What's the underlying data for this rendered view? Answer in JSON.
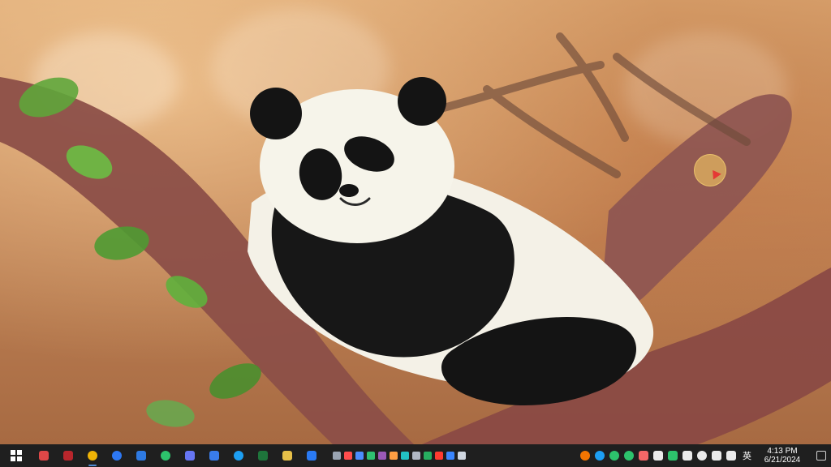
{
  "wallpaper": {
    "subject": "sleeping-panda-on-tree-branch"
  },
  "taskbar": {
    "start_icon": "windows-start-icon",
    "pinned_apps": [
      {
        "name": "bug-report-icon",
        "color": "#e84a4a"
      },
      {
        "name": "filezilla-icon",
        "color": "#c1272d"
      },
      {
        "name": "chrome-icon",
        "color": "#fbbc05"
      },
      {
        "name": "sync-icon",
        "color": "#2e7dff"
      },
      {
        "name": "vs-code-like-icon",
        "color": "#2f80ed"
      },
      {
        "name": "wechat-icon",
        "color": "#2ecc71"
      },
      {
        "name": "swift-arrow-icon",
        "color": "#6c7bff"
      },
      {
        "name": "lark-icon",
        "color": "#3b82f6"
      },
      {
        "name": "edge-icon",
        "color": "#1ea7ff"
      },
      {
        "name": "excel-icon",
        "color": "#1f7a3d"
      },
      {
        "name": "file-explorer-icon",
        "color": "#f2c94c"
      },
      {
        "name": "vscode-icon",
        "color": "#2b7fff"
      }
    ],
    "mini_tray": [
      {
        "name": "settings-mini-icon",
        "color": "#9aa4b2"
      },
      {
        "name": "red-mini-icon",
        "color": "#ff4d4d"
      },
      {
        "name": "blue-mini-icon",
        "color": "#4c8dff"
      },
      {
        "name": "green-mini-icon",
        "color": "#2fbf71"
      },
      {
        "name": "purple-mini-icon",
        "color": "#9b59b6"
      },
      {
        "name": "orange-mini-icon",
        "color": "#ff9f43"
      },
      {
        "name": "cyan-mini-icon",
        "color": "#22c1c3"
      },
      {
        "name": "gray-mini-icon",
        "color": "#b0b7c3"
      },
      {
        "name": "green-mini-icon-2",
        "color": "#27ae60"
      },
      {
        "name": "red-record-icon",
        "color": "#ff3b30"
      },
      {
        "name": "blue-mini-icon-2",
        "color": "#3a86ff"
      },
      {
        "name": "gray-mini-icon-2",
        "color": "#cfd6e0"
      }
    ],
    "right_tray": [
      {
        "name": "firefox-icon",
        "color": "#ff7a00",
        "shape": "round"
      },
      {
        "name": "edge-tray-icon",
        "color": "#1ea7ff",
        "shape": "round"
      },
      {
        "name": "chat-tray-icon",
        "color": "#2ecc71",
        "shape": "round"
      },
      {
        "name": "shield-tray-icon",
        "color": "#2ecc71",
        "shape": "round"
      },
      {
        "name": "mic-tray-icon",
        "color": "#ff6b6b",
        "shape": "square"
      },
      {
        "name": "cloud-tray-icon",
        "color": "#f5f5f5",
        "shape": "square"
      },
      {
        "name": "wechat-tray-icon",
        "color": "#2ecc71",
        "shape": "square"
      },
      {
        "name": "phone-tray-icon",
        "color": "#f5f5f5",
        "shape": "square"
      },
      {
        "name": "globe-tray-icon",
        "color": "#f5f5f5",
        "shape": "round"
      },
      {
        "name": "speaker-tray-icon",
        "color": "#f5f5f5",
        "shape": "square"
      },
      {
        "name": "wifi-tray-icon",
        "color": "#f5f5f5",
        "shape": "square"
      }
    ],
    "ime_label": "英",
    "clock": {
      "time": "4:13 PM",
      "date": "6/21/2024"
    }
  }
}
